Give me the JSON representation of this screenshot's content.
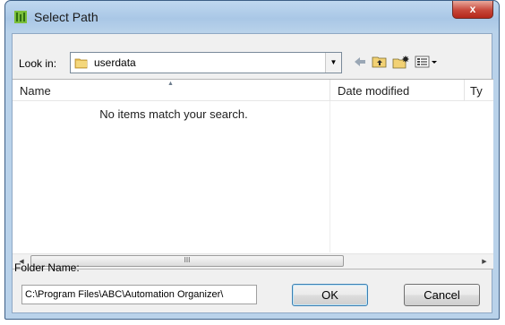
{
  "window": {
    "title": "Select Path",
    "close_label": "x"
  },
  "look_in": {
    "label": "Look in:",
    "value": "userdata"
  },
  "toolbar": {
    "back_icon": "back-arrow-icon",
    "up_icon": "up-folder-icon",
    "new_folder_icon": "new-folder-icon",
    "view_icon": "view-menu-icon"
  },
  "list": {
    "columns": [
      "Name",
      "Date modified",
      "Ty"
    ],
    "empty_message": "No items match your search.",
    "scroll_thumb_grip": "III"
  },
  "folder_name": {
    "label": "Folder Name:",
    "value": "C:\\Program Files\\ABC\\Automation Organizer\\"
  },
  "buttons": {
    "ok": "OK",
    "cancel": "Cancel"
  },
  "colors": {
    "title_gradient": "#bfd8ef",
    "close": "#c7473a",
    "client_bg": "#f0f0f0"
  }
}
